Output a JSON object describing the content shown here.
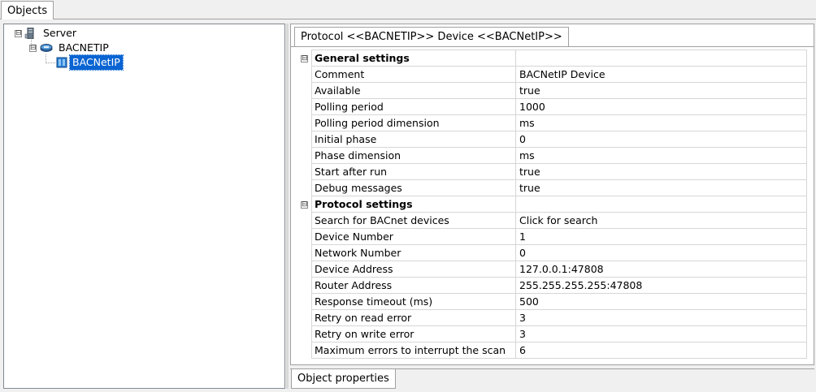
{
  "tabs": {
    "objects": "Objects"
  },
  "tree": {
    "server": {
      "label": "Server",
      "expander": "⊟"
    },
    "protocol": {
      "label": "BACNETIP",
      "expander": "⊟"
    },
    "device": {
      "label": "BACNetIP"
    }
  },
  "properties": {
    "tab_title": "Protocol <<BACNETIP>> Device <<BACNetIP>>",
    "bottom_tab": "Object properties",
    "sections": [
      {
        "title": "General settings",
        "collapse": "⊟",
        "rows": [
          {
            "name": "Comment",
            "value": "BACNetIP Device"
          },
          {
            "name": "Available",
            "value": "true"
          },
          {
            "name": "Polling period",
            "value": "1000"
          },
          {
            "name": "Polling period dimension",
            "value": "ms"
          },
          {
            "name": "Initial phase",
            "value": "0"
          },
          {
            "name": "Phase dimension",
            "value": "ms"
          },
          {
            "name": "Start after run",
            "value": "true"
          },
          {
            "name": "Debug messages",
            "value": "true"
          }
        ]
      },
      {
        "title": "Protocol settings",
        "collapse": "⊟",
        "rows": [
          {
            "name": "Search for BACnet devices",
            "value": "Click for search"
          },
          {
            "name": "Device Number",
            "value": "1"
          },
          {
            "name": "Network Number",
            "value": "0"
          },
          {
            "name": "Device Address",
            "value": "127.0.0.1:47808"
          },
          {
            "name": "Router Address",
            "value": "255.255.255.255:47808"
          },
          {
            "name": "Response timeout (ms)",
            "value": "500"
          },
          {
            "name": "Retry on read error",
            "value": "3"
          },
          {
            "name": "Retry on write error",
            "value": "3"
          },
          {
            "name": "Maximum errors to interrupt the scan",
            "value": "6"
          }
        ]
      }
    ]
  },
  "colors": {
    "selection": "#0a64d2",
    "grid_line": "#d6d6d6",
    "border": "#a0a0a0"
  }
}
